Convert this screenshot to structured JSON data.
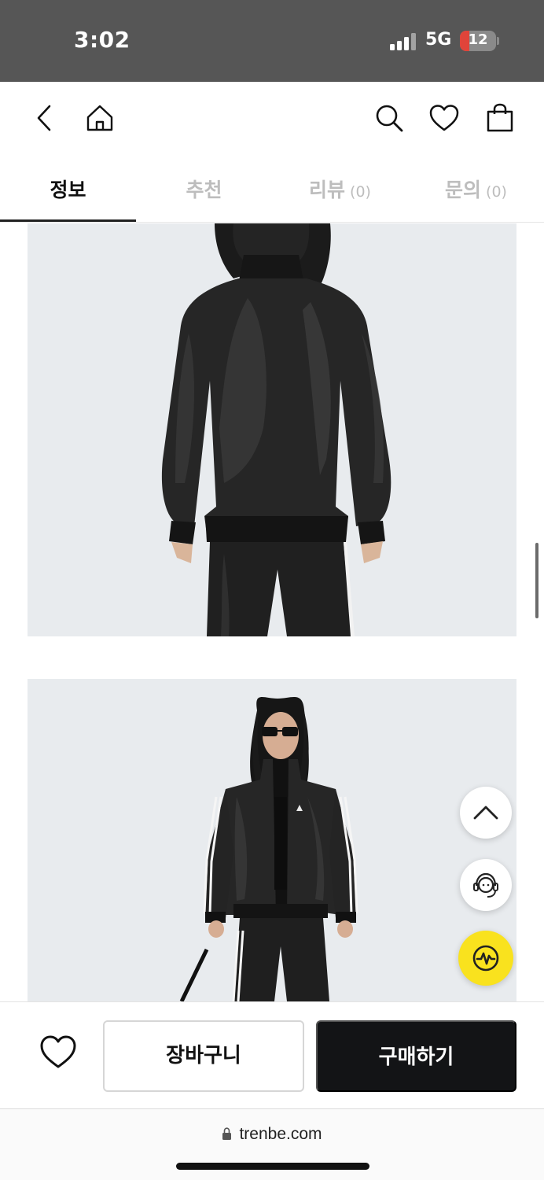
{
  "status_bar": {
    "time": "3:02",
    "network": "5G",
    "battery": "12",
    "icons": [
      "signal-bars-icon",
      "battery-icon"
    ]
  },
  "header": {
    "icons": [
      "back-arrow-icon",
      "home-icon",
      "search-icon",
      "heart-icon",
      "shopping-bag-icon"
    ]
  },
  "tabs": [
    {
      "label": "정보",
      "count": "",
      "active": true
    },
    {
      "label": "추천",
      "count": ""
    },
    {
      "label": "리뷰",
      "count": "(0)"
    },
    {
      "label": "문의",
      "count": "(0)"
    }
  ],
  "floating": {
    "icons": [
      "scroll-top-chevron-icon",
      "customer-service-agent-icon",
      "pulse-wave-icon"
    ],
    "accent": "#f9e21e"
  },
  "actions": {
    "wish_icon": "heart-outline-icon",
    "cart_label": "장바구니",
    "buy_label": "구매하기"
  },
  "browser": {
    "url": "trenbe.com",
    "lock_icon": "lock-icon"
  },
  "colors": {
    "status_bar": "#565656",
    "buy_button": "#131416",
    "photo_bg": "#e8ebee",
    "inactive_tab": "#bdbdbd"
  }
}
